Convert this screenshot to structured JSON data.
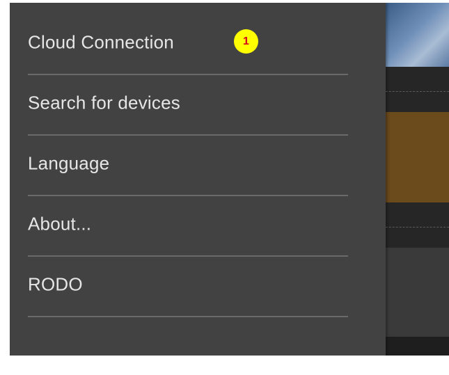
{
  "drawer": {
    "items": [
      {
        "label": "Cloud Connection"
      },
      {
        "label": "Search for devices"
      },
      {
        "label": "Language"
      },
      {
        "label": "About..."
      },
      {
        "label": "RODO"
      }
    ],
    "badge": "1"
  },
  "colors": {
    "drawer_background": "#424242",
    "divider": "#6a6a6a",
    "text": "#e6e6e6",
    "badge_fill": "#ffff00",
    "badge_text": "#d4001a"
  }
}
